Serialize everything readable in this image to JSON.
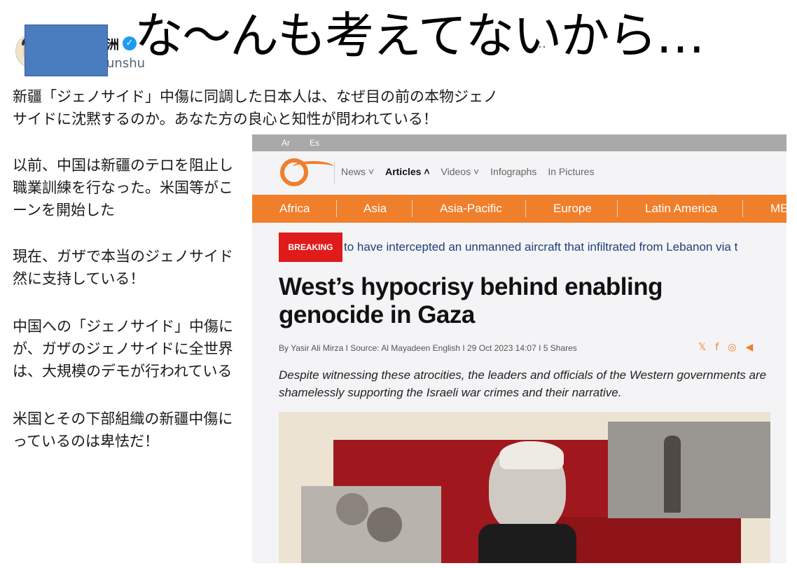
{
  "overlay_caption": "な～んも考えてないから…",
  "tweet": {
    "name": "洲",
    "handle": "unshu",
    "more": "…",
    "paragraphs": [
      [
        "新疆「ジェノサイド」中傷に同調した日本人は、なぜ目の前の本物ジェノ",
        "サイドに沈黙するのか。あなた方の良心と知性が問われている！"
      ],
      [
        "以前、中国は新疆のテロを阻止し",
        "職業訓練を行なった。米国等がこ",
        "ーンを開始した"
      ],
      [
        "現在、ガザで本当のジェノサイド",
        "然に支持している！"
      ],
      [
        "中国への「ジェノサイド」中傷に",
        "が、ガザのジェノサイドに全世界",
        "は、大規模のデモが行われている"
      ],
      [
        "米国とその下部組織の新疆中傷に",
        "っているのは卑怯だ！"
      ]
    ]
  },
  "article": {
    "lang_links": [
      "Ar",
      "Es"
    ],
    "nav": [
      {
        "label": "News ˅"
      },
      {
        "label": "Articles ˄",
        "active": true
      },
      {
        "label": "Videos ˅"
      },
      {
        "label": "Infographs"
      },
      {
        "label": "In Pictures"
      }
    ],
    "regions": [
      "Africa",
      "Asia",
      "Asia-Pacific",
      "Europe",
      "Latin America",
      "ME"
    ],
    "breaking_label": "BREAKING",
    "ticker": "to have intercepted an unmanned aircraft that infiltrated from Lebanon via t",
    "headline_lines": [
      "West’s hypocrisy behind enabling",
      "genocide in Gaza"
    ],
    "byline": "By Yasir Ali Mirza  I Source: Al Mayadeen English I 29 Oct 2023 14:07 I 5 Shares",
    "share_icons": [
      "𝕏",
      "f",
      "◎",
      "◀"
    ],
    "summary": "Despite witnessing these atrocities, the leaders and officials of the Western governments are shamelessly supporting the Israeli war crimes and their narrative.",
    "accent_color": "#f07f2c"
  }
}
